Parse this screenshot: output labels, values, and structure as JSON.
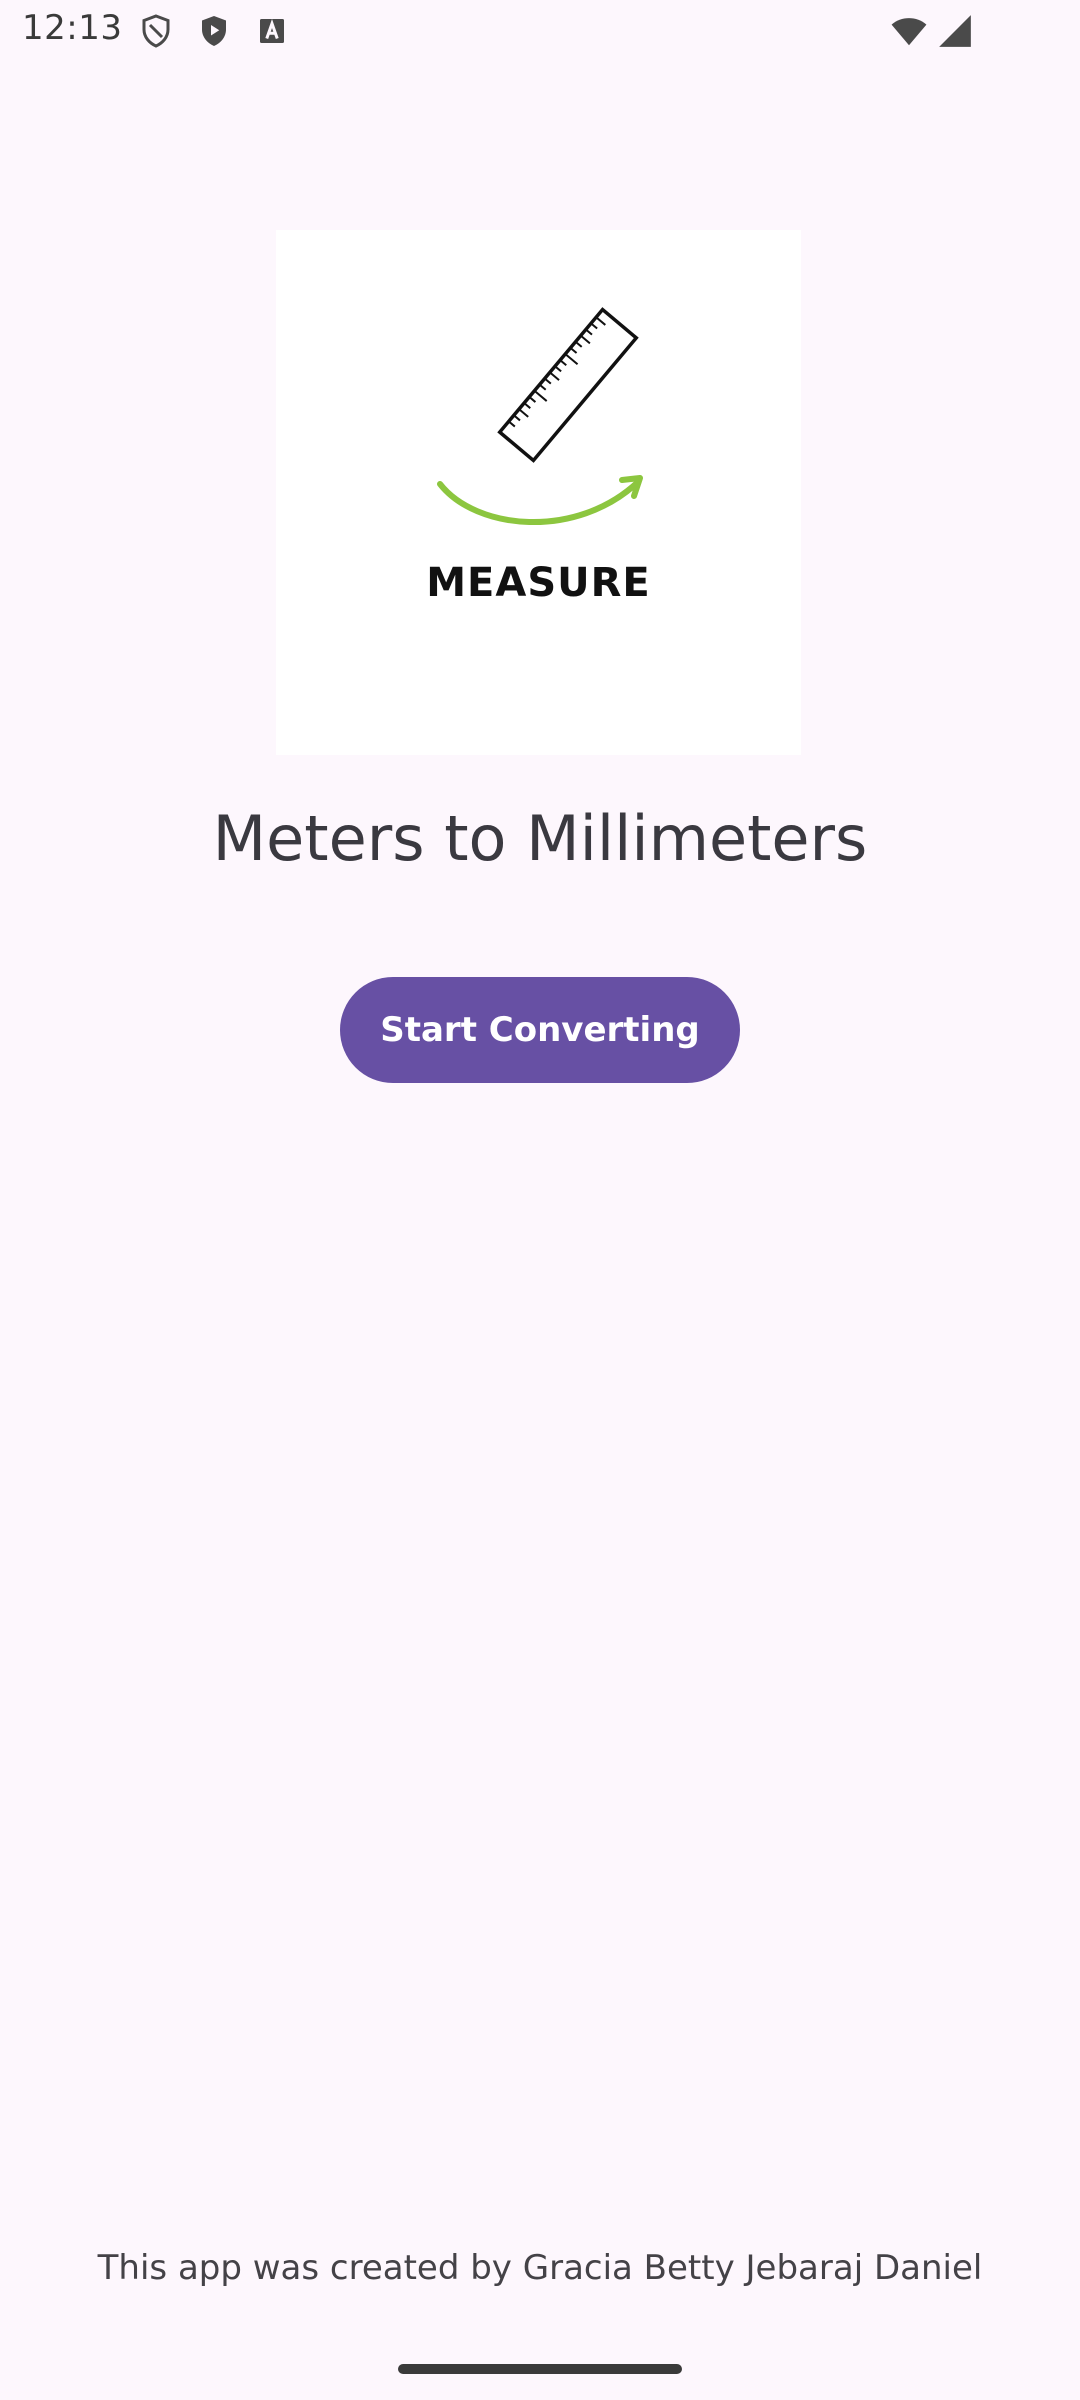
{
  "status_bar": {
    "time": "12:13",
    "left_icons": [
      "shield-outline-icon",
      "shield-play-icon",
      "a-box-icon"
    ],
    "right_icons": [
      "wifi-icon",
      "cell-signal-icon"
    ]
  },
  "logo": {
    "text": "MEASURE",
    "icon": "ruler-icon",
    "arrow_color": "#8cc63f"
  },
  "title": "Meters to Millimeters",
  "start_button": {
    "label": "Start Converting",
    "color": "#6750a4"
  },
  "credit": "This app was created by Gracia Betty Jebaraj Daniel"
}
